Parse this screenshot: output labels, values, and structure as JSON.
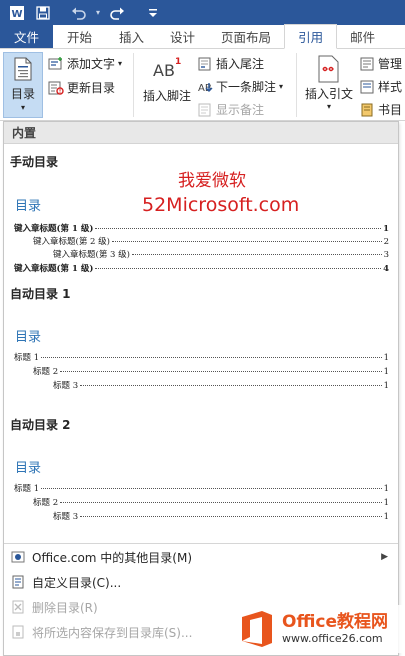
{
  "qat": {
    "icons": [
      "word-app-icon",
      "save-icon",
      "undo-icon",
      "redo-icon",
      "customize-qat-icon"
    ]
  },
  "tabs": [
    {
      "label": "文件"
    },
    {
      "label": "开始"
    },
    {
      "label": "插入"
    },
    {
      "label": "设计"
    },
    {
      "label": "页面布局"
    },
    {
      "label": "引用"
    },
    {
      "label": "邮件"
    }
  ],
  "ribbon": {
    "toc": {
      "label": "目录"
    },
    "add_text": "添加文字",
    "update_toc": "更新目录",
    "insert_footnote": "插入脚注",
    "insert_endnote": "插入尾注",
    "next_footnote": "下一条脚注",
    "show_notes": "显示备注",
    "insert_citation": "插入引文",
    "manage": "管理",
    "style": "样式",
    "bibliography": "书目"
  },
  "dropdown": {
    "header": "内置",
    "manual": {
      "title": "手动目录",
      "preview_title": "目录",
      "lines": [
        {
          "text": "键入章标题(第 1 级)",
          "page": "1"
        },
        {
          "text": "键入章标题(第 2 级)",
          "page": "2"
        },
        {
          "text": "键入章标题(第 3 级)",
          "page": "3"
        },
        {
          "text": "键入章标题(第 1 级)",
          "page": "4"
        }
      ]
    },
    "auto1": {
      "title": "自动目录 1",
      "preview_title": "目录",
      "lines": [
        {
          "text": "标题 1",
          "page": "1"
        },
        {
          "text": "标题 2",
          "page": "1"
        },
        {
          "text": "标题 3",
          "page": "1"
        }
      ]
    },
    "auto2": {
      "title": "自动目录 2",
      "preview_title": "目录",
      "lines": [
        {
          "text": "标题 1",
          "page": "1"
        },
        {
          "text": "标题 2",
          "page": "1"
        },
        {
          "text": "标题 3",
          "page": "1"
        }
      ]
    },
    "menu": [
      {
        "label": "Office.com 中的其他目录(M)"
      },
      {
        "label": "自定义目录(C)..."
      },
      {
        "label": "删除目录(R)"
      },
      {
        "label": "将所选内容保存到目录库(S)..."
      }
    ]
  },
  "watermark": {
    "line1": "我爱微软",
    "line2": "52Microsoft.com"
  },
  "logo": {
    "brand": "Office教程网",
    "url": "www.office26.com"
  },
  "colors": {
    "word_blue": "#2b579a",
    "accent_text": "#2e74b5",
    "watermark_red": "#d62020",
    "logo_orange": "#e8551d"
  }
}
